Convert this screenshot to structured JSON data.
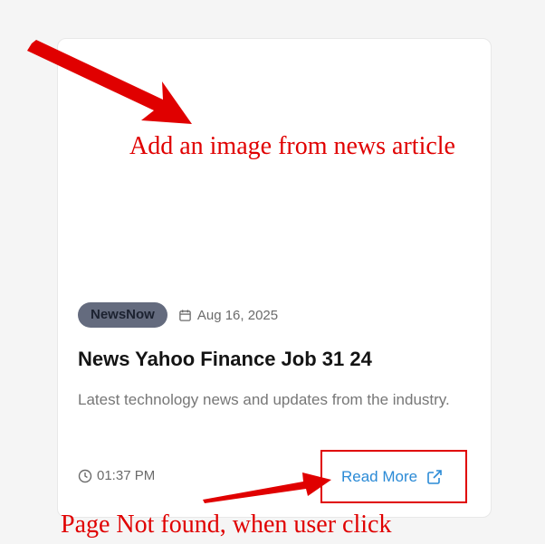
{
  "card": {
    "source_badge": "NewsNow",
    "date": "Aug 16, 2025",
    "title": "News Yahoo Finance Job 31 24",
    "description": "Latest technology news and updates from the industry.",
    "time": "01:37 PM",
    "read_more_label": "Read More",
    "icons": {
      "date": "calendar-icon",
      "time": "clock-icon",
      "read_more": "external-link-icon"
    }
  },
  "annotations": {
    "image_note": "Add an image from news article",
    "link_note": "Page Not found, when user click",
    "color": "#e00000"
  },
  "colors": {
    "badge_background": "#646b7e",
    "link": "#2a8ad6",
    "page_background": "#f5f5f5"
  }
}
